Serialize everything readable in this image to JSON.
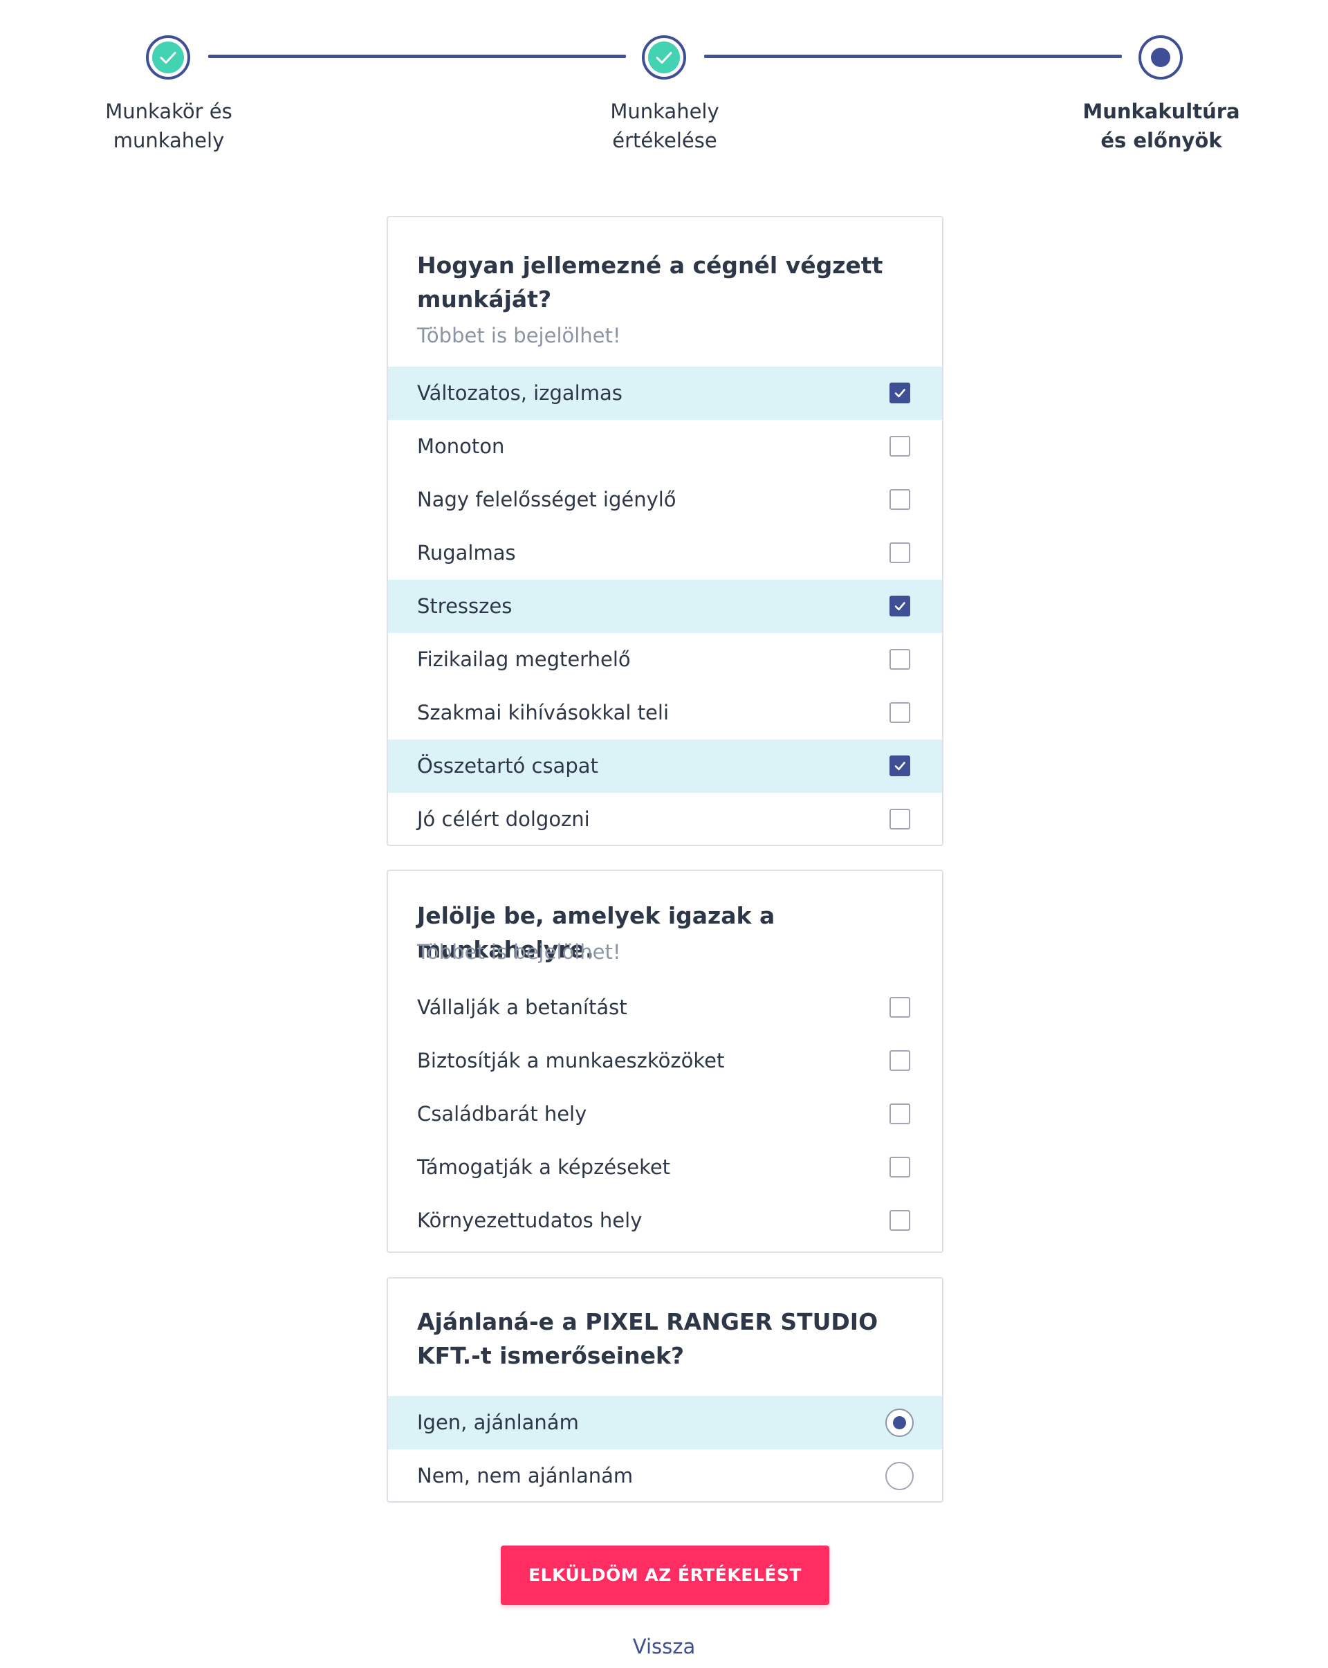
{
  "stepper": {
    "steps": [
      {
        "line1": "Munkakör és",
        "line2": "munkahely",
        "state": "completed"
      },
      {
        "line1": "Munkahely",
        "line2": "értékelése",
        "state": "completed"
      },
      {
        "line1": "Munkakultúra",
        "line2": "és előnyök",
        "state": "active"
      }
    ]
  },
  "question1": {
    "title": "Hogyan jellemezné a cégnél végzett munkáját?",
    "hint": "Többet is bejelölhet!",
    "options": [
      {
        "label": "Változatos, izgalmas",
        "checked": true
      },
      {
        "label": "Monoton",
        "checked": false
      },
      {
        "label": "Nagy felelősséget igénylő",
        "checked": false
      },
      {
        "label": "Rugalmas",
        "checked": false
      },
      {
        "label": "Stresszes",
        "checked": true
      },
      {
        "label": "Fizikailag megterhelő",
        "checked": false
      },
      {
        "label": "Szakmai kihívásokkal teli",
        "checked": false
      },
      {
        "label": "Összetartó csapat",
        "checked": true
      },
      {
        "label": "Jó célért dolgozni",
        "checked": false
      }
    ]
  },
  "question2": {
    "title": "Jelölje be, amelyek igazak a munkahelyre.",
    "hint": "Többet is bejelölhet!",
    "options": [
      {
        "label": "Vállalják a betanítást",
        "checked": false
      },
      {
        "label": "Biztosítják a munkaeszközöket",
        "checked": false
      },
      {
        "label": "Családbarát hely",
        "checked": false
      },
      {
        "label": "Támogatják a képzéseket",
        "checked": false
      },
      {
        "label": "Környezettudatos hely",
        "checked": false
      }
    ]
  },
  "question3": {
    "title": "Ajánlaná-e a PIXEL RANGER STUDIO KFT.-t ismerőseinek?",
    "options": [
      {
        "label": "Igen, ajánlanám",
        "selected": true
      },
      {
        "label": "Nem, nem ajánlanám",
        "selected": false
      }
    ]
  },
  "actions": {
    "submit_label": "ELKÜLDÖM AZ ÉRTÉKELÉST",
    "back_label": "Vissza"
  },
  "colors": {
    "primary": "#3f4f96",
    "success": "#43d3b2",
    "selected_row": "#dbf2f6",
    "submit": "#ff2d62"
  }
}
